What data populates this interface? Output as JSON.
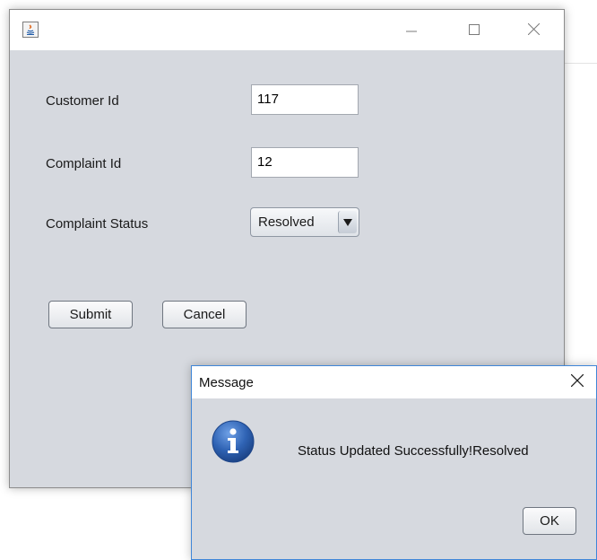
{
  "main_window": {
    "title": "",
    "controls": {
      "minimize_icon": "minimize-icon",
      "maximize_icon": "maximize-icon",
      "close_icon": "close-icon"
    },
    "form": {
      "customer_id": {
        "label": "Customer Id",
        "value": "117"
      },
      "complaint_id": {
        "label": "Complaint Id",
        "value": "12"
      },
      "complaint_status": {
        "label": "Complaint Status",
        "selected": "Resolved"
      }
    },
    "buttons": {
      "submit": "Submit",
      "cancel": "Cancel"
    }
  },
  "dialog": {
    "title": "Message",
    "message": "Status Updated Successfully!Resolved",
    "ok": "OK",
    "icon": "info-icon"
  },
  "colors": {
    "window_bg": "#d6d9df",
    "dialog_border": "#3f86d8",
    "info_blue": "#2f63b4"
  }
}
